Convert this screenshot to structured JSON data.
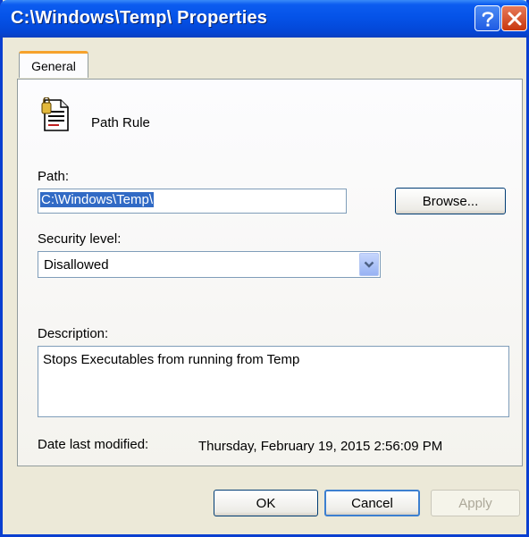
{
  "window": {
    "title": "C:\\Windows\\Temp\\ Properties",
    "titlebar_color": "#0553E8",
    "help_icon": "question-icon",
    "close_icon": "close-x-icon"
  },
  "tabs": [
    {
      "label": "General",
      "active": true
    }
  ],
  "rule": {
    "icon": "path-rule-icon",
    "type_label": "Path Rule"
  },
  "path": {
    "label": "Path:",
    "value": "C:\\Windows\\Temp\\",
    "browse_label": "Browse..."
  },
  "security": {
    "label": "Security level:",
    "selected": "Disallowed"
  },
  "description": {
    "label": "Description:",
    "value": "Stops Executables from running from Temp"
  },
  "modified": {
    "label": "Date last modified:",
    "value": "Thursday, February 19, 2015  2:56:09 PM"
  },
  "buttons": {
    "ok": "OK",
    "cancel": "Cancel",
    "apply": "Apply"
  }
}
